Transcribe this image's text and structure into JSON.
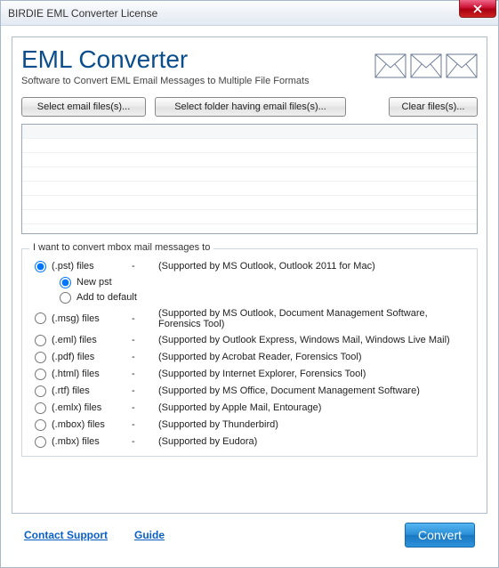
{
  "titlebar": {
    "text": "BIRDIE EML Converter License"
  },
  "header": {
    "title": "EML Converter",
    "subtitle": "Software to Convert EML Email Messages to Multiple File Formats"
  },
  "buttons": {
    "select_files": "Select email files(s)...",
    "select_folder": "Select folder having email files(s)...",
    "clear": "Clear files(s)..."
  },
  "group": {
    "label": "I want to convert mbox mail messages to"
  },
  "options": [
    {
      "name": "(.pst) files",
      "dash": "-",
      "support": "(Supported by MS Outlook, Outlook 2011 for Mac)",
      "checked": true
    },
    {
      "name": "(.msg) files",
      "dash": "-",
      "support": "(Supported by MS Outlook, Document Management Software, Forensics Tool)",
      "checked": false
    },
    {
      "name": "(.eml) files",
      "dash": "-",
      "support": "(Supported by Outlook Express,  Windows Mail, Windows Live Mail)",
      "checked": false
    },
    {
      "name": "(.pdf) files",
      "dash": "-",
      "support": "(Supported by Acrobat Reader, Forensics Tool)",
      "checked": false
    },
    {
      "name": "(.html) files",
      "dash": "-",
      "support": "(Supported by Internet Explorer, Forensics Tool)",
      "checked": false
    },
    {
      "name": "(.rtf) files",
      "dash": "-",
      "support": "(Supported by MS Office, Document Management Software)",
      "checked": false
    },
    {
      "name": "(.emlx) files",
      "dash": "-",
      "support": "(Supported by Apple Mail, Entourage)",
      "checked": false
    },
    {
      "name": "(.mbox) files",
      "dash": "-",
      "support": "(Supported by Thunderbird)",
      "checked": false
    },
    {
      "name": "(.mbx) files",
      "dash": "-",
      "support": "(Supported by Eudora)",
      "checked": false
    }
  ],
  "sub_options": [
    {
      "name": "New pst",
      "checked": true
    },
    {
      "name": "Add to default",
      "checked": false
    }
  ],
  "footer": {
    "contact": "Contact Support",
    "guide": "Guide",
    "convert": "Convert"
  }
}
